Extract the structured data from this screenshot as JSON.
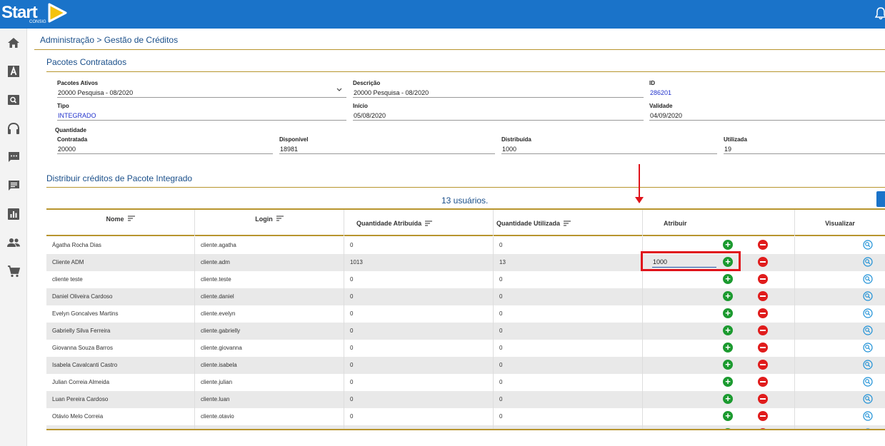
{
  "app": {
    "logo_text": "Start",
    "logo_sub": "CONSIG"
  },
  "breadcrumb": "Administração > Gestão de Créditos",
  "sidebar": [
    "home-icon",
    "font-icon",
    "search-icon",
    "headset-icon",
    "chat-icon",
    "message-icon",
    "chart-icon",
    "users-icon",
    "cart-icon"
  ],
  "pacotes": {
    "title": "Pacotes Contratados",
    "ativos_label": "Pacotes Ativos",
    "ativos_value": "20000 Pesquisa - 08/2020",
    "descricao_label": "Descrição",
    "descricao_value": "20000 Pesquisa - 08/2020",
    "id_label": "ID",
    "id_value": "286201",
    "tipo_label": "Tipo",
    "tipo_value": "INTEGRADO",
    "inicio_label": "Início",
    "inicio_value": "05/08/2020",
    "validade_label": "Validade",
    "validade_value": "04/09/2020",
    "quantidade_label": "Quantidade",
    "contratada_label": "Contratada",
    "contratada_value": "20000",
    "disponivel_label": "Disponível",
    "disponivel_value": "18981",
    "distribuida_label": "Distribuída",
    "distribuida_value": "1000",
    "utilizada_label": "Utilizada",
    "utilizada_value": "19"
  },
  "distribuir": {
    "title": "Distribuir créditos de Pacote Integrado",
    "users_count": "13 usuários."
  },
  "table": {
    "headers": {
      "nome": "Nome",
      "login": "Login",
      "qtd_atribuida": "Quantidade Atribuída",
      "qtd_utilizada": "Quantidade Utilizada",
      "atribuir": "Atribuir",
      "visualizar": "Visualizar"
    },
    "rows": [
      {
        "nome": "Ágatha Rocha Dias",
        "login": "cliente.agatha",
        "atribuida": "0",
        "utilizada": "0",
        "input": ""
      },
      {
        "nome": "Cliente ADM",
        "login": "cliente.adm",
        "atribuida": "1013",
        "utilizada": "13",
        "input": "1000"
      },
      {
        "nome": "cliente teste",
        "login": "cliente.teste",
        "atribuida": "0",
        "utilizada": "0",
        "input": ""
      },
      {
        "nome": "Daniel Oliveira Cardoso",
        "login": "cliente.daniel",
        "atribuida": "0",
        "utilizada": "0",
        "input": ""
      },
      {
        "nome": "Evelyn Goncalves Martins",
        "login": "cliente.evelyn",
        "atribuida": "0",
        "utilizada": "0",
        "input": ""
      },
      {
        "nome": "Gabrielly Silva Ferreira",
        "login": "cliente.gabrielly",
        "atribuida": "0",
        "utilizada": "0",
        "input": ""
      },
      {
        "nome": "Giovanna Souza Barros",
        "login": "cliente.giovanna",
        "atribuida": "0",
        "utilizada": "0",
        "input": ""
      },
      {
        "nome": "Isabela Cavalcanti Castro",
        "login": "cliente.isabela",
        "atribuida": "0",
        "utilizada": "0",
        "input": ""
      },
      {
        "nome": "Julian Correia Almeida",
        "login": "cliente.julian",
        "atribuida": "0",
        "utilizada": "0",
        "input": ""
      },
      {
        "nome": "Luan Pereira Cardoso",
        "login": "cliente.luan",
        "atribuida": "0",
        "utilizada": "0",
        "input": ""
      },
      {
        "nome": "Otávio Melo Correia",
        "login": "cliente.otavio",
        "atribuida": "0",
        "utilizada": "0",
        "input": ""
      },
      {
        "nome": "",
        "login": "",
        "atribuida": "",
        "utilizada": "",
        "input": ""
      }
    ]
  },
  "colors": {
    "topbar": "#1a73c9",
    "accent_gold": "#b8952e",
    "plus_green": "#1b9a2f",
    "minus_red": "#e01c1c",
    "annotation_red": "#e0141c"
  }
}
